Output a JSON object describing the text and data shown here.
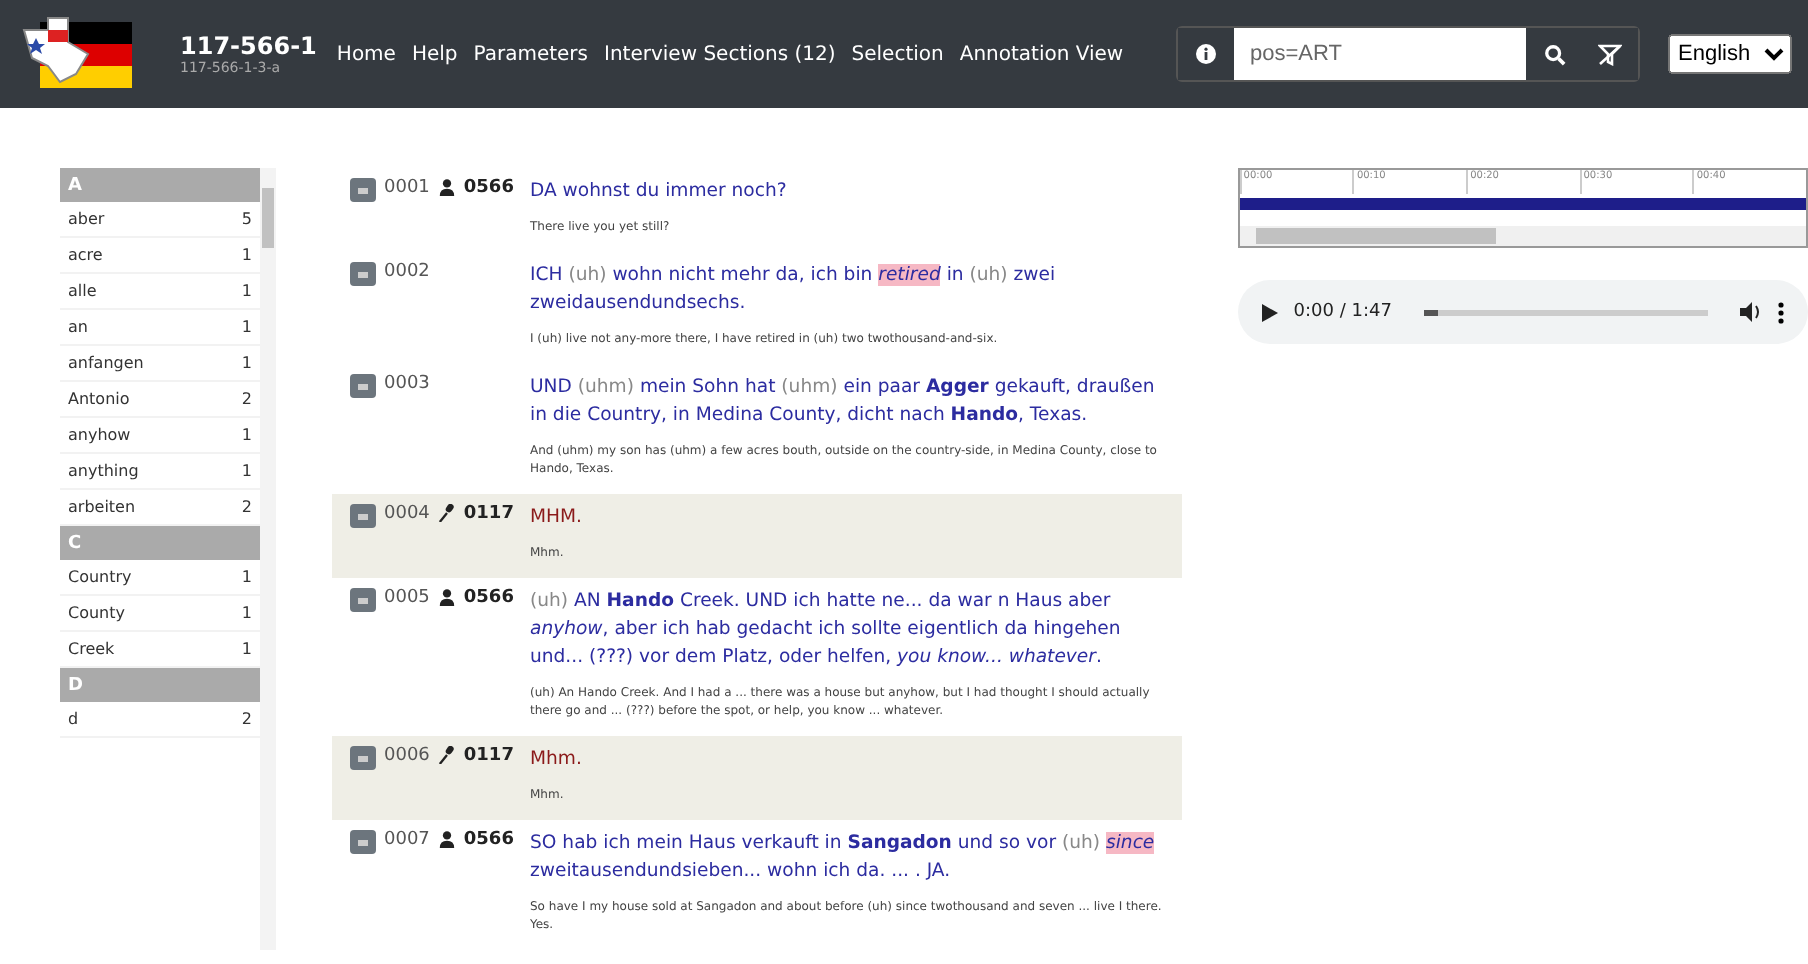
{
  "header": {
    "title": "117-566-1",
    "subtitle": "117-566-1-3-a",
    "nav": [
      "Home",
      "Help",
      "Parameters",
      "Interview Sections (12)",
      "Selection",
      "Annotation View"
    ],
    "search": {
      "value": "pos=ART"
    },
    "language": "English"
  },
  "word_list": {
    "groups": [
      {
        "letter": "A",
        "words": [
          {
            "word": "aber",
            "count": "5"
          },
          {
            "word": "acre",
            "count": "1"
          },
          {
            "word": "alle",
            "count": "1"
          },
          {
            "word": "an",
            "count": "1"
          },
          {
            "word": "anfangen",
            "count": "1"
          },
          {
            "word": "Antonio",
            "count": "2"
          },
          {
            "word": "anyhow",
            "count": "1"
          },
          {
            "word": "anything",
            "count": "1"
          },
          {
            "word": "arbeiten",
            "count": "2"
          }
        ]
      },
      {
        "letter": "C",
        "words": [
          {
            "word": "Country",
            "count": "1"
          },
          {
            "word": "County",
            "count": "1"
          },
          {
            "word": "Creek",
            "count": "1"
          }
        ]
      },
      {
        "letter": "D",
        "words": [
          {
            "word": "d",
            "count": "2"
          }
        ]
      }
    ]
  },
  "transcript": [
    {
      "number": "0001",
      "kind": "informant",
      "speaker": "0566",
      "segments": [
        {
          "kind": "plain",
          "text": "DA wohnst du immer noch?"
        }
      ],
      "translation": "There live you yet still?"
    },
    {
      "number": "0002",
      "kind": "none",
      "segments": [
        {
          "kind": "plain",
          "text": "ICH "
        },
        {
          "kind": "filler",
          "text": "(uh)"
        },
        {
          "kind": "plain",
          "text": " wohn nicht mehr da, ich bin "
        },
        {
          "kind": "highlight",
          "text": "retired"
        },
        {
          "kind": "plain",
          "text": " in "
        },
        {
          "kind": "filler",
          "text": "(uh)"
        },
        {
          "kind": "plain",
          "text": " zwei zweidausendundsechs."
        }
      ],
      "translation": "I (uh) live not any-more there, I have retired in (uh) two twothousand-and-six."
    },
    {
      "number": "0003",
      "kind": "none",
      "segments": [
        {
          "kind": "plain",
          "text": "UND "
        },
        {
          "kind": "filler",
          "text": "(uhm)"
        },
        {
          "kind": "plain",
          "text": " mein Sohn hat "
        },
        {
          "kind": "filler",
          "text": "(uhm)"
        },
        {
          "kind": "plain",
          "text": " ein paar "
        },
        {
          "kind": "bold",
          "text": "Agger"
        },
        {
          "kind": "plain",
          "text": " gekauft, draußen in die Country, in Medina County, dicht nach "
        },
        {
          "kind": "bold",
          "text": "Hando"
        },
        {
          "kind": "plain",
          "text": ", Texas."
        }
      ],
      "translation": "And (uhm) my son has (uhm) a few acres bouth, outside on the country-side, in Medina County, close to Hando, Texas."
    },
    {
      "number": "0004",
      "kind": "interviewer",
      "speaker": "0117",
      "segments": [
        {
          "kind": "plain",
          "text": "MHM."
        }
      ],
      "translation": "Mhm."
    },
    {
      "number": "0005",
      "kind": "informant",
      "speaker": "0566",
      "segments": [
        {
          "kind": "filler",
          "text": "(uh)"
        },
        {
          "kind": "plain",
          "text": " AN "
        },
        {
          "kind": "bold",
          "text": "Hando"
        },
        {
          "kind": "plain",
          "text": " Creek. UND ich hatte ne... da war n Haus aber "
        },
        {
          "kind": "italic",
          "text": "anyhow"
        },
        {
          "kind": "plain",
          "text": ", aber ich hab gedacht ich sollte eigentlich da hingehen und... (???) vor dem Platz, oder helfen, "
        },
        {
          "kind": "italic",
          "text": "you know... whatever"
        },
        {
          "kind": "plain",
          "text": "."
        }
      ],
      "translation": "(uh) An Hando Creek. And I had a ... there was a house but anyhow, but I had thought I should actually there go and ... (???) before the spot, or help, you know ... whatever."
    },
    {
      "number": "0006",
      "kind": "interviewer",
      "speaker": "0117",
      "segments": [
        {
          "kind": "plain",
          "text": "Mhm."
        }
      ],
      "translation": "Mhm."
    },
    {
      "number": "0007",
      "kind": "informant",
      "speaker": "0566",
      "segments": [
        {
          "kind": "plain",
          "text": "SO hab ich mein Haus verkauft in "
        },
        {
          "kind": "bold",
          "text": "Sangadon"
        },
        {
          "kind": "plain",
          "text": " und so vor "
        },
        {
          "kind": "filler",
          "text": "(uh) "
        },
        {
          "kind": "highlight",
          "text": "since"
        },
        {
          "kind": "plain",
          "text": " zweitausendundsieben... wohn ich da. ... . JA."
        }
      ],
      "translation": "So have I my house sold at Sangadon and about before (uh) since twothousand and seven ... live I there. Yes."
    }
  ],
  "timeline": {
    "ticks": [
      "00:00",
      "00:10",
      "00:20",
      "00:30",
      "00:40"
    ]
  },
  "player": {
    "time": "0:00 / 1:47",
    "level": 0.05
  }
}
